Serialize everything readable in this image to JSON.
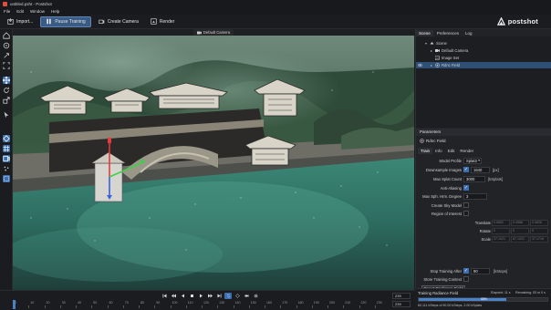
{
  "window": {
    "title": "untitled.psht - Postshot"
  },
  "menu": [
    "File",
    "Edit",
    "Window",
    "Help"
  ],
  "toolbar": {
    "import_label": "Import...",
    "pause_label": "Pause Training",
    "create_camera_label": "Create Camera",
    "render_label": "Render",
    "brand": "postshot"
  },
  "viewport": {
    "camera_tab": "Default Camera"
  },
  "scene_panel": {
    "tabs": [
      "Scene",
      "Preferences",
      "Log"
    ],
    "tree": [
      {
        "label": "Scene",
        "level": 0
      },
      {
        "label": "Default Camera",
        "level": 1
      },
      {
        "label": "Image Set",
        "level": 1
      },
      {
        "label": "Rdnc Field",
        "level": 1
      }
    ]
  },
  "parameters": {
    "header": "Parameters",
    "object": "Rdnc Field",
    "tabs": [
      "Train",
      "Info",
      "Edit",
      "Render"
    ],
    "model_profile": {
      "label": "Model Profile",
      "value": "Splat3"
    },
    "downsample": {
      "label": "Downsample Images",
      "value": "1640",
      "unit": "[px]"
    },
    "max_splat": {
      "label": "Max Splat Count",
      "value": "3000",
      "unit": "[kSplats]"
    },
    "anti_aliasing": {
      "label": "Anti-Aliasing"
    },
    "max_sph": {
      "label": "Max Sph. Hrm. Degree",
      "value": "3"
    },
    "create_sky": {
      "label": "Create Sky Model"
    },
    "roi": {
      "label": "Region of Interest"
    },
    "translate": {
      "label": "Translate",
      "values": [
        "0.0652",
        "0.4988",
        "0.0626"
      ]
    },
    "rotate": {
      "label": "Rotate",
      "values": [
        "0",
        "0",
        "0"
      ]
    },
    "scale": {
      "label": "Scale",
      "values": [
        "37.1021",
        "67.1022",
        "37.1718"
      ]
    },
    "stop_after": {
      "label": "Stop Training After",
      "value": "90",
      "unit": "[kSteps]"
    },
    "store_context": {
      "label": "Store Training Context"
    },
    "reset_button": "Reset Radiance Field"
  },
  "training": {
    "title": "Training Radiance Field",
    "elapsed": "Elapsed: 11 s",
    "remaining": "Remaining: 53 m 0 s",
    "progress_pct": 68,
    "progress_label": "68%",
    "stats": "60,111 kSteps of 90.00 kSteps, 2.00 kSplats"
  },
  "timeline": {
    "current_frame": "239",
    "end_frame": "239",
    "ticks": [
      "0",
      "10",
      "20",
      "30",
      "40",
      "50",
      "60",
      "70",
      "80",
      "90",
      "100",
      "110",
      "120",
      "130",
      "140",
      "150",
      "160",
      "170",
      "180",
      "190",
      "200",
      "210",
      "220",
      "230"
    ]
  }
}
